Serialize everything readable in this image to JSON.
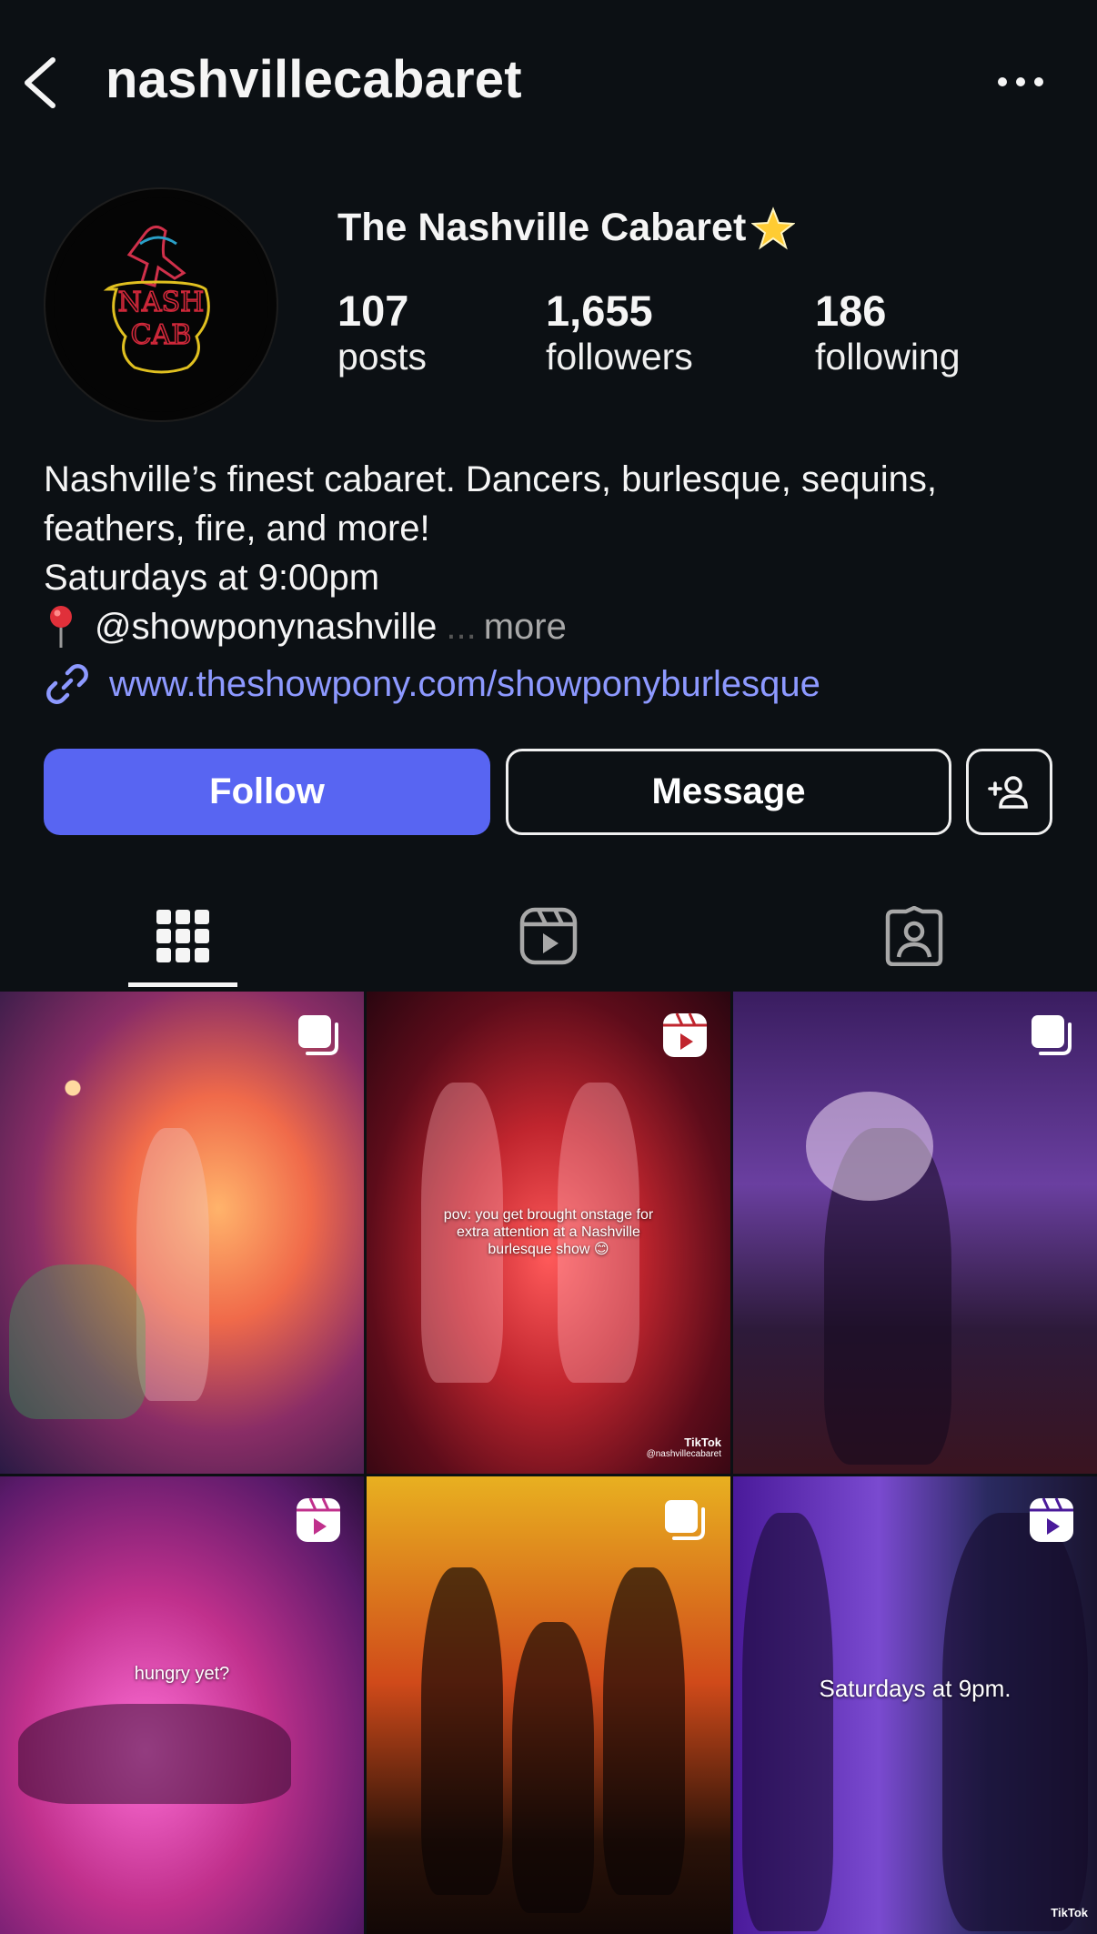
{
  "header": {
    "username": "nashvillecabaret"
  },
  "profile": {
    "display_name": "The Nashville Cabaret",
    "avatar_text": [
      "NASH",
      "CAB"
    ],
    "stats": [
      {
        "value": "107",
        "label": "posts"
      },
      {
        "value": "1,655",
        "label": "followers"
      },
      {
        "value": "186",
        "label": "following"
      }
    ]
  },
  "bio": {
    "line1": "Nashville’s finest cabaret. Dancers, burlesque, sequins,",
    "line2": "feathers, fire, and more!",
    "line3": "Saturdays at 9:00pm",
    "handle": "@showponynashville",
    "ellipsis": "...",
    "more": "more",
    "link": "www.theshowpony.com/showponyburlesque"
  },
  "actions": {
    "follow": "Follow",
    "message": "Message"
  },
  "tabs": [
    {
      "icon": "grid-icon",
      "active": true
    },
    {
      "icon": "reels-icon",
      "active": false
    },
    {
      "icon": "tagged-icon",
      "active": false
    }
  ],
  "posts": [
    {
      "type": "carousel",
      "overlay": ""
    },
    {
      "type": "reel",
      "overlay": "pov: you get brought onstage for extra attention at a Nashville burlesque show 😊",
      "watermark": "TikTok",
      "watermark_handle": "@nashvillecabaret"
    },
    {
      "type": "carousel",
      "overlay": ""
    },
    {
      "type": "reel",
      "overlay": "hungry yet?"
    },
    {
      "type": "carousel",
      "overlay": ""
    },
    {
      "type": "reel",
      "overlay": "Saturdays at 9pm.",
      "watermark": "TikTok"
    }
  ],
  "colors": {
    "background": "#0c1014",
    "follow_button": "#5865f2",
    "link": "#8d99ff"
  }
}
